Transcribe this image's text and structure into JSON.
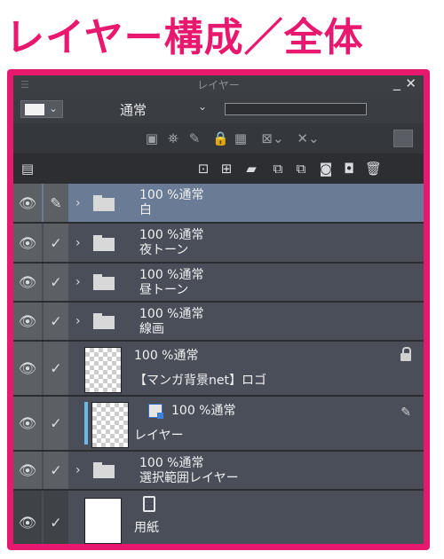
{
  "heading": "レイヤー構成／全体",
  "panel": {
    "title": "レイヤー",
    "minimize": "_",
    "close": "✕",
    "blend_mode": "通常",
    "chevron": "⌄"
  },
  "toolbar_icons_row2": [
    "clip-icon",
    "ref-layer-icon",
    "draft-icon",
    "lock-icon",
    "lock-transparent-icon",
    "mask-enable-icon",
    "mask-display-icon",
    "color-icon"
  ],
  "toolbar_icons_row3": [
    "layer-menu-icon",
    "new-raster-icon",
    "new-vector-icon",
    "new-folder-icon",
    "merge-icon",
    "combine-icon",
    "mask-icon",
    "mask-apply-icon",
    "trash-icon"
  ],
  "layers": [
    {
      "opacity_mode": "100 %通常",
      "name": "白",
      "type": "folder"
    },
    {
      "opacity_mode": "100 %通常",
      "name": "夜トーン",
      "type": "folder"
    },
    {
      "opacity_mode": "100 %通常",
      "name": "昼トーン",
      "type": "folder"
    },
    {
      "opacity_mode": "100 %通常",
      "name": "線画",
      "type": "folder"
    },
    {
      "opacity_mode": "100 %通常",
      "name": "【マンガ背景net】ロゴ",
      "type": "raster"
    },
    {
      "opacity_mode": "100 %通常",
      "name": "レイヤー",
      "type": "raster"
    },
    {
      "opacity_mode": "100 %通常",
      "name": "選択範囲レイヤー",
      "type": "folder"
    },
    {
      "opacity_mode": "",
      "name": "用紙",
      "type": "paper"
    }
  ]
}
